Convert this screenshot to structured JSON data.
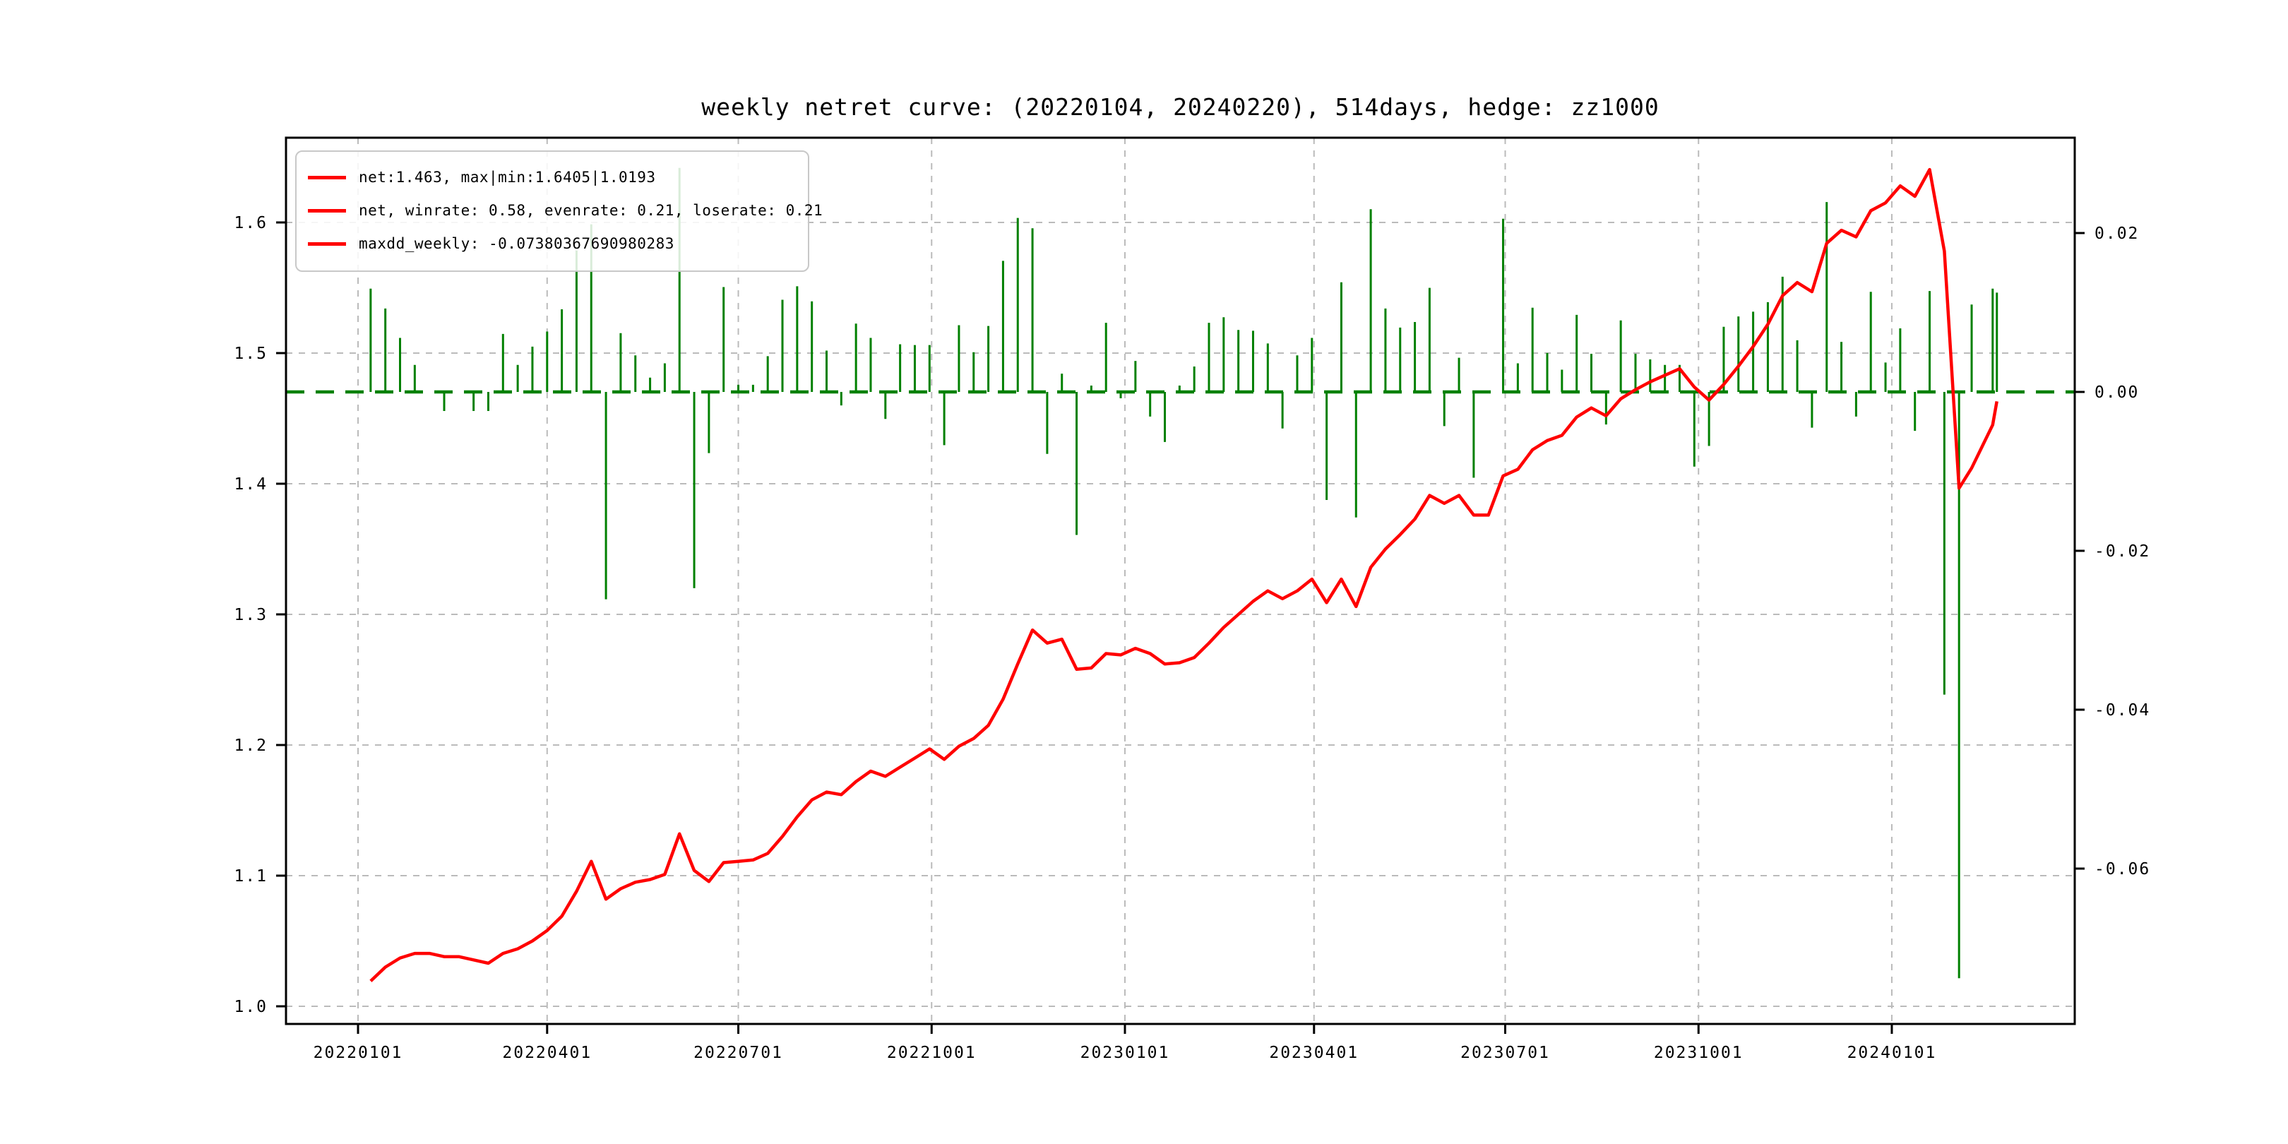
{
  "title": "weekly netret curve: (20220104, 20240220), 514days, hedge: zz1000",
  "legend": {
    "items": [
      {
        "label": "net:1.463, max|min:1.6405|1.0193"
      },
      {
        "label": "net, winrate: 0.58, evenrate: 0.21, loserate: 0.21"
      },
      {
        "label": "maxdd_weekly: -0.07380367690980283"
      }
    ]
  },
  "colors": {
    "net_line": "#ff0000",
    "bars": "#008000",
    "zero_line": "#008000",
    "grid": "#bbbbbb",
    "axis": "#000000",
    "legend_border": "#c8c8c8",
    "background": "#ffffff"
  },
  "chart_data": {
    "type": "line+bar",
    "title": "weekly netret curve: (20220104, 20240220), 514days, hedge: zz1000",
    "period_start": "20220104",
    "period_end": "20240220",
    "days": 514,
    "hedge": "zz1000",
    "net_final": 1.463,
    "net_max": 1.6405,
    "net_min": 1.0193,
    "winrate": 0.58,
    "evenrate": 0.21,
    "loserate": 0.21,
    "maxdd_weekly": -0.07380367690980283,
    "grid": true,
    "legend_position": "upper left",
    "x_tick_labels": [
      "20220101",
      "20220401",
      "20220701",
      "20221001",
      "20230101",
      "20230401",
      "20230701",
      "20231001",
      "20240101"
    ],
    "left_axis": {
      "labels": [
        "1.0",
        "1.1",
        "1.2",
        "1.3",
        "1.4",
        "1.5",
        "1.6"
      ],
      "values": [
        1.0,
        1.1,
        1.2,
        1.3,
        1.4,
        1.5,
        1.6
      ],
      "range": [
        0.985,
        1.675
      ]
    },
    "right_axis": {
      "labels": [
        "0.02",
        "0.00",
        "-0.02",
        "-0.04",
        "-0.06"
      ],
      "values": [
        0.02,
        0.0,
        -0.02,
        -0.04,
        -0.06
      ],
      "range": [
        -0.079,
        0.034
      ]
    },
    "zero_line_value": 0.0,
    "dates": [
      "20220107",
      "20220114",
      "20220121",
      "20220128",
      "20220204",
      "20220211",
      "20220218",
      "20220225",
      "20220304",
      "20220311",
      "20220318",
      "20220325",
      "20220401",
      "20220408",
      "20220415",
      "20220422",
      "20220429",
      "20220506",
      "20220513",
      "20220520",
      "20220527",
      "20220603",
      "20220610",
      "20220617",
      "20220624",
      "20220701",
      "20220708",
      "20220715",
      "20220722",
      "20220729",
      "20220805",
      "20220812",
      "20220819",
      "20220826",
      "20220902",
      "20220909",
      "20220916",
      "20220923",
      "20220930",
      "20221007",
      "20221014",
      "20221021",
      "20221028",
      "20221104",
      "20221111",
      "20221118",
      "20221125",
      "20221202",
      "20221209",
      "20221216",
      "20221223",
      "20221230",
      "20230106",
      "20230113",
      "20230120",
      "20230127",
      "20230203",
      "20230210",
      "20230217",
      "20230224",
      "20230303",
      "20230310",
      "20230317",
      "20230324",
      "20230331",
      "20230407",
      "20230414",
      "20230421",
      "20230428",
      "20230505",
      "20230512",
      "20230519",
      "20230526",
      "20230602",
      "20230609",
      "20230616",
      "20230623",
      "20230630",
      "20230707",
      "20230714",
      "20230721",
      "20230728",
      "20230804",
      "20230811",
      "20230818",
      "20230825",
      "20230901",
      "20230908",
      "20230915",
      "20230922",
      "20230929",
      "20231006",
      "20231013",
      "20231020",
      "20231027",
      "20231103",
      "20231110",
      "20231117",
      "20231124",
      "20231201",
      "20231208",
      "20231215",
      "20231222",
      "20231229",
      "20240105",
      "20240112",
      "20240119",
      "20240126",
      "20240202",
      "20240208",
      "20240218",
      "20240220"
    ],
    "series": [
      {
        "name": "net",
        "type": "line",
        "color": "#ff0000",
        "values": [
          1.0193,
          1.03,
          1.037,
          1.0405,
          1.0405,
          1.038,
          1.038,
          1.0355,
          1.033,
          1.0405,
          1.044,
          1.05,
          1.058,
          1.069,
          1.088,
          1.111,
          1.082,
          1.09,
          1.095,
          1.097,
          1.101,
          1.132,
          1.104,
          1.0955,
          1.11,
          1.111,
          1.112,
          1.117,
          1.13,
          1.145,
          1.158,
          1.164,
          1.162,
          1.172,
          1.18,
          1.176,
          1.183,
          1.19,
          1.197,
          1.189,
          1.199,
          1.205,
          1.215,
          1.235,
          1.262,
          1.288,
          1.278,
          1.281,
          1.258,
          1.259,
          1.27,
          1.269,
          1.274,
          1.27,
          1.262,
          1.263,
          1.267,
          1.278,
          1.29,
          1.3,
          1.31,
          1.318,
          1.312,
          1.318,
          1.327,
          1.309,
          1.327,
          1.306,
          1.336,
          1.35,
          1.361,
          1.373,
          1.391,
          1.385,
          1.391,
          1.376,
          1.376,
          1.406,
          1.411,
          1.426,
          1.433,
          1.437,
          1.451,
          1.458,
          1.452,
          1.465,
          1.472,
          1.478,
          1.483,
          1.488,
          1.474,
          1.464,
          1.476,
          1.49,
          1.505,
          1.522,
          1.544,
          1.554,
          1.547,
          1.584,
          1.594,
          1.589,
          1.609,
          1.615,
          1.628,
          1.62,
          1.6405,
          1.578,
          1.3966,
          1.412,
          1.445,
          1.463
        ]
      },
      {
        "name": "weekly_return",
        "type": "bar",
        "color": "#008000",
        "values": [
          0.013,
          0.0105,
          0.0068,
          0.0034,
          0.0,
          -0.0024,
          0.0,
          -0.0024,
          -0.0024,
          0.0073,
          0.0034,
          0.0057,
          0.0076,
          0.0104,
          0.0178,
          0.0211,
          -0.0261,
          0.0074,
          0.0046,
          0.0018,
          0.0036,
          0.0282,
          -0.0247,
          -0.0077,
          0.0132,
          0.0009,
          0.0009,
          0.0045,
          0.0116,
          0.0133,
          0.0114,
          0.0052,
          -0.0017,
          0.0086,
          0.0068,
          -0.0034,
          0.006,
          0.0059,
          0.0059,
          -0.0067,
          0.0084,
          0.005,
          0.0083,
          0.0165,
          0.0219,
          0.0206,
          -0.0078,
          0.0023,
          -0.018,
          0.0008,
          0.0087,
          -0.0008,
          0.0039,
          -0.0031,
          -0.0063,
          0.0008,
          0.0032,
          0.0087,
          0.0094,
          0.0078,
          0.0077,
          0.0061,
          -0.0046,
          0.0046,
          0.0068,
          -0.0136,
          0.0138,
          -0.0158,
          0.023,
          0.0105,
          0.0081,
          0.0088,
          0.0131,
          -0.0043,
          0.0043,
          -0.0108,
          0.0,
          0.0218,
          0.0036,
          0.0106,
          0.0049,
          0.0028,
          0.0097,
          0.0048,
          -0.0041,
          0.009,
          0.0048,
          0.0041,
          0.0034,
          0.0034,
          -0.0094,
          -0.0068,
          0.0082,
          0.0095,
          0.0101,
          0.0113,
          0.0145,
          0.0065,
          -0.0045,
          0.0239,
          0.0063,
          -0.0031,
          0.0126,
          0.0037,
          0.008,
          -0.0049,
          0.0127,
          -0.0381,
          -0.0738,
          0.011,
          0.013,
          0.0125
        ]
      }
    ]
  }
}
